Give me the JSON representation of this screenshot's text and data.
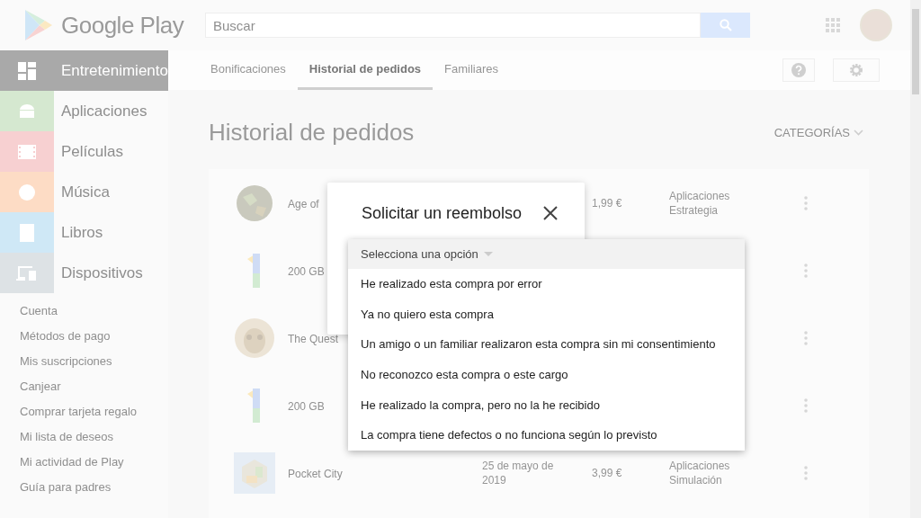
{
  "header": {
    "logo": "Google Play",
    "search": {
      "placeholder": "Buscar"
    }
  },
  "sidebar": {
    "categories": [
      {
        "label": "Entretenimiento",
        "selected": true,
        "color": "#a9a9a9"
      },
      {
        "label": "Aplicaciones",
        "selected": false,
        "color": "#d5e8d0"
      },
      {
        "label": "Películas",
        "selected": false,
        "color": "#f7d0d1"
      },
      {
        "label": "Música",
        "selected": false,
        "color": "#fddcc5"
      },
      {
        "label": "Libros",
        "selected": false,
        "color": "#cfe8f6"
      },
      {
        "label": "Dispositivos",
        "selected": false,
        "color": "#dde2e5"
      }
    ],
    "links": [
      "Cuenta",
      "Métodos de pago",
      "Mis suscripciones",
      "Canjear",
      "Comprar tarjeta regalo",
      "Mi lista de deseos",
      "Mi actividad de Play",
      "Guía para padres"
    ]
  },
  "tabs": [
    {
      "label": "Bonificaciones",
      "selected": false
    },
    {
      "label": "Historial de pedidos",
      "selected": true
    },
    {
      "label": "Familiares",
      "selected": false
    }
  ],
  "page_title": "Historial de pedidos",
  "categories_button": "CATEGORÍAS",
  "orders": [
    {
      "kind": "globe",
      "name": "Age of",
      "price": "1,99 €",
      "category_lines": [
        "Aplicaciones",
        "Estrategia"
      ]
    },
    {
      "kind": "one",
      "name": "200 GB"
    },
    {
      "kind": "mask",
      "name": "The Quest"
    },
    {
      "kind": "one",
      "name": "200 GB"
    },
    {
      "kind": "city",
      "name": "Pocket City",
      "date_lines": [
        "25 de mayo de",
        "2019"
      ],
      "price": "3,99 €",
      "category_lines": [
        "Aplicaciones",
        "Simulación"
      ]
    }
  ],
  "dialog": {
    "title": "Solicitar un reembolso",
    "dropdown": {
      "placeholder": "Selecciona una opción",
      "options": [
        "He realizado esta compra por error",
        "Ya no quiero esta compra",
        "Un amigo o un familiar realizaron esta compra sin mi consentimiento",
        "No reconozco esta compra o este cargo",
        "He realizado la compra, pero no la he recibido",
        "La compra tiene defectos o no funciona según lo previsto"
      ]
    }
  }
}
